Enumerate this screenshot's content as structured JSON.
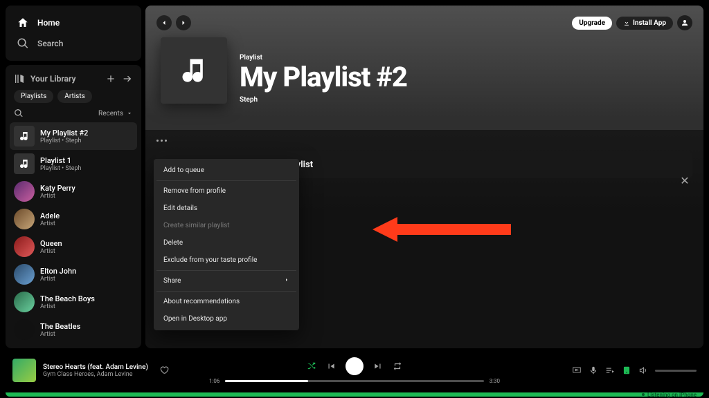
{
  "nav": {
    "home": "Home",
    "search": "Search"
  },
  "library": {
    "title": "Your Library",
    "chips": [
      "Playlists",
      "Artists"
    ],
    "sort_label": "Recents",
    "items": [
      {
        "title": "My Playlist #2",
        "sub": "Playlist • Steph",
        "round": false,
        "cls": "",
        "selected": true
      },
      {
        "title": "Playlist 1",
        "sub": "Playlist • Steph",
        "round": false,
        "cls": "",
        "selected": false
      },
      {
        "title": "Katy Perry",
        "sub": "Artist",
        "round": true,
        "cls": "kp",
        "selected": false
      },
      {
        "title": "Adele",
        "sub": "Artist",
        "round": true,
        "cls": "ad",
        "selected": false
      },
      {
        "title": "Queen",
        "sub": "Artist",
        "round": true,
        "cls": "qn",
        "selected": false
      },
      {
        "title": "Elton John",
        "sub": "Artist",
        "round": true,
        "cls": "ej",
        "selected": false
      },
      {
        "title": "The Beach Boys",
        "sub": "Artist",
        "round": true,
        "cls": "bb",
        "selected": false
      },
      {
        "title": "The Beatles",
        "sub": "Artist",
        "round": true,
        "cls": "tb",
        "selected": false
      }
    ]
  },
  "top_right": {
    "upgrade": "Upgrade",
    "install": "Install App"
  },
  "hero": {
    "type": "Playlist",
    "title": "My Playlist #2",
    "owner": "Steph"
  },
  "find": {
    "title": "Let's find something for your playlist"
  },
  "ctx_menu": [
    {
      "label": "Add to queue",
      "sep": true
    },
    {
      "label": "Remove from profile"
    },
    {
      "label": "Edit details"
    },
    {
      "label": "Create similar playlist",
      "disabled": true
    },
    {
      "label": "Delete"
    },
    {
      "label": "Exclude from your taste profile",
      "sep": true
    },
    {
      "label": "Share",
      "submenu": true,
      "sep": true
    },
    {
      "label": "About recommendations"
    },
    {
      "label": "Open in Desktop app"
    }
  ],
  "player": {
    "now_playing_title": "Stereo Hearts (feat. Adam Levine)",
    "now_playing_sub": "Gym Class Heroes, Adam Levine",
    "elapsed": "1:06",
    "total": "3:30"
  },
  "footer": {
    "listening": "Listening on iPhone"
  }
}
